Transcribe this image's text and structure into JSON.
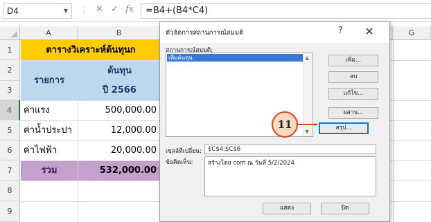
{
  "formula_bar": {
    "name_box": "D4",
    "cancel_glyph": "✕",
    "enter_glyph": "✓",
    "fx_label": "fx",
    "formula": "=B4+(B4*C4)"
  },
  "columns": [
    "A",
    "B",
    "C",
    "D",
    "E",
    "F",
    "G"
  ],
  "rows": [
    "1",
    "2",
    "3",
    "4",
    "5",
    "6",
    "7",
    "8",
    "9"
  ],
  "sheet": {
    "title": "ตารางวิเคราะห์ต้นทุนก",
    "header_item": "รายการ",
    "header_cost": "ต้นทุน",
    "header_year": "ปี 2566",
    "items": [
      {
        "label": "ค่าแรง",
        "value": "500,000.00"
      },
      {
        "label": "ค่าน้ำประปา",
        "value": "12,000.00"
      },
      {
        "label": "ค่าไฟฟ้า",
        "value": "20,000.00"
      }
    ],
    "total_label": "รวม",
    "total_value": "532,000.00"
  },
  "dialog": {
    "title": "ตัวจัดการสถานการณ์สมมติ",
    "help": "?",
    "close": "✕",
    "list_label": "สถานการณ์สมมติ:",
    "scenarios": [
      "เพิ่มต้นทุน"
    ],
    "buttons": {
      "add": "เพิ่ม...",
      "delete": "ลบ",
      "edit": "แก้ไข...",
      "merge": "ผสาน...",
      "summary": "สรุป..."
    },
    "changing_cells_label": "เซลล์ที่เปลี่ยน:",
    "changing_cells": "$C$4:$C$6",
    "comment_label": "ข้อคิดเห็น:",
    "comment": "สร้างโดย com ณ วันที่ 5/2/2024",
    "show": "แสดง",
    "close_button": "ปิด"
  },
  "callout": {
    "number": "11",
    "color": "#d9431f"
  }
}
